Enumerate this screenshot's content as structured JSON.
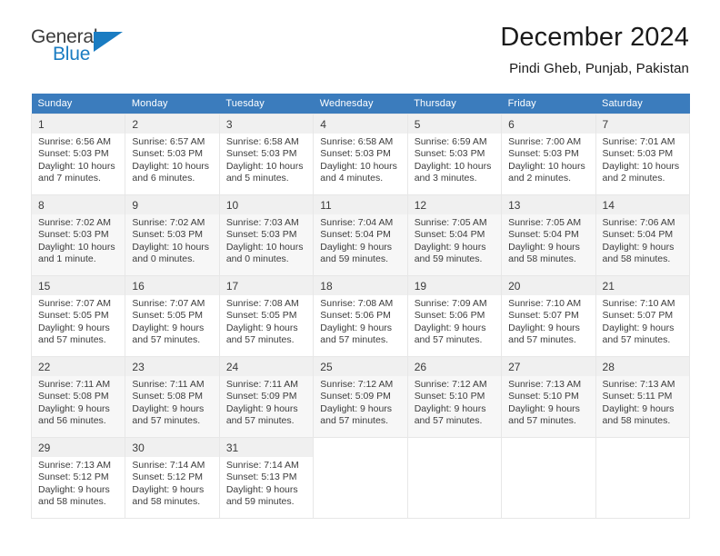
{
  "logo": {
    "word_one": "General",
    "word_two": "Blue",
    "triangle_icon": "triangle-icon",
    "brand_blue": "#1a7cc2",
    "brand_dark": "#3c3c3c"
  },
  "header": {
    "title": "December 2024",
    "subtitle": "Pindi Gheb, Punjab, Pakistan"
  },
  "calendar": {
    "header_bg": "#3b7cbd",
    "header_text_color": "#ffffff",
    "weekdays": [
      "Sunday",
      "Monday",
      "Tuesday",
      "Wednesday",
      "Thursday",
      "Friday",
      "Saturday"
    ],
    "labels": {
      "sunrise": "Sunrise:",
      "sunset": "Sunset:",
      "daylight": "Daylight:"
    },
    "weeks": [
      [
        {
          "day": "1",
          "sunrise": "Sunrise: 6:56 AM",
          "sunset": "Sunset: 5:03 PM",
          "daylight": "Daylight: 10 hours and 7 minutes."
        },
        {
          "day": "2",
          "sunrise": "Sunrise: 6:57 AM",
          "sunset": "Sunset: 5:03 PM",
          "daylight": "Daylight: 10 hours and 6 minutes."
        },
        {
          "day": "3",
          "sunrise": "Sunrise: 6:58 AM",
          "sunset": "Sunset: 5:03 PM",
          "daylight": "Daylight: 10 hours and 5 minutes."
        },
        {
          "day": "4",
          "sunrise": "Sunrise: 6:58 AM",
          "sunset": "Sunset: 5:03 PM",
          "daylight": "Daylight: 10 hours and 4 minutes."
        },
        {
          "day": "5",
          "sunrise": "Sunrise: 6:59 AM",
          "sunset": "Sunset: 5:03 PM",
          "daylight": "Daylight: 10 hours and 3 minutes."
        },
        {
          "day": "6",
          "sunrise": "Sunrise: 7:00 AM",
          "sunset": "Sunset: 5:03 PM",
          "daylight": "Daylight: 10 hours and 2 minutes."
        },
        {
          "day": "7",
          "sunrise": "Sunrise: 7:01 AM",
          "sunset": "Sunset: 5:03 PM",
          "daylight": "Daylight: 10 hours and 2 minutes."
        }
      ],
      [
        {
          "day": "8",
          "sunrise": "Sunrise: 7:02 AM",
          "sunset": "Sunset: 5:03 PM",
          "daylight": "Daylight: 10 hours and 1 minute."
        },
        {
          "day": "9",
          "sunrise": "Sunrise: 7:02 AM",
          "sunset": "Sunset: 5:03 PM",
          "daylight": "Daylight: 10 hours and 0 minutes."
        },
        {
          "day": "10",
          "sunrise": "Sunrise: 7:03 AM",
          "sunset": "Sunset: 5:03 PM",
          "daylight": "Daylight: 10 hours and 0 minutes."
        },
        {
          "day": "11",
          "sunrise": "Sunrise: 7:04 AM",
          "sunset": "Sunset: 5:04 PM",
          "daylight": "Daylight: 9 hours and 59 minutes."
        },
        {
          "day": "12",
          "sunrise": "Sunrise: 7:05 AM",
          "sunset": "Sunset: 5:04 PM",
          "daylight": "Daylight: 9 hours and 59 minutes."
        },
        {
          "day": "13",
          "sunrise": "Sunrise: 7:05 AM",
          "sunset": "Sunset: 5:04 PM",
          "daylight": "Daylight: 9 hours and 58 minutes."
        },
        {
          "day": "14",
          "sunrise": "Sunrise: 7:06 AM",
          "sunset": "Sunset: 5:04 PM",
          "daylight": "Daylight: 9 hours and 58 minutes."
        }
      ],
      [
        {
          "day": "15",
          "sunrise": "Sunrise: 7:07 AM",
          "sunset": "Sunset: 5:05 PM",
          "daylight": "Daylight: 9 hours and 57 minutes."
        },
        {
          "day": "16",
          "sunrise": "Sunrise: 7:07 AM",
          "sunset": "Sunset: 5:05 PM",
          "daylight": "Daylight: 9 hours and 57 minutes."
        },
        {
          "day": "17",
          "sunrise": "Sunrise: 7:08 AM",
          "sunset": "Sunset: 5:05 PM",
          "daylight": "Daylight: 9 hours and 57 minutes."
        },
        {
          "day": "18",
          "sunrise": "Sunrise: 7:08 AM",
          "sunset": "Sunset: 5:06 PM",
          "daylight": "Daylight: 9 hours and 57 minutes."
        },
        {
          "day": "19",
          "sunrise": "Sunrise: 7:09 AM",
          "sunset": "Sunset: 5:06 PM",
          "daylight": "Daylight: 9 hours and 57 minutes."
        },
        {
          "day": "20",
          "sunrise": "Sunrise: 7:10 AM",
          "sunset": "Sunset: 5:07 PM",
          "daylight": "Daylight: 9 hours and 57 minutes."
        },
        {
          "day": "21",
          "sunrise": "Sunrise: 7:10 AM",
          "sunset": "Sunset: 5:07 PM",
          "daylight": "Daylight: 9 hours and 57 minutes."
        }
      ],
      [
        {
          "day": "22",
          "sunrise": "Sunrise: 7:11 AM",
          "sunset": "Sunset: 5:08 PM",
          "daylight": "Daylight: 9 hours and 56 minutes."
        },
        {
          "day": "23",
          "sunrise": "Sunrise: 7:11 AM",
          "sunset": "Sunset: 5:08 PM",
          "daylight": "Daylight: 9 hours and 57 minutes."
        },
        {
          "day": "24",
          "sunrise": "Sunrise: 7:11 AM",
          "sunset": "Sunset: 5:09 PM",
          "daylight": "Daylight: 9 hours and 57 minutes."
        },
        {
          "day": "25",
          "sunrise": "Sunrise: 7:12 AM",
          "sunset": "Sunset: 5:09 PM",
          "daylight": "Daylight: 9 hours and 57 minutes."
        },
        {
          "day": "26",
          "sunrise": "Sunrise: 7:12 AM",
          "sunset": "Sunset: 5:10 PM",
          "daylight": "Daylight: 9 hours and 57 minutes."
        },
        {
          "day": "27",
          "sunrise": "Sunrise: 7:13 AM",
          "sunset": "Sunset: 5:10 PM",
          "daylight": "Daylight: 9 hours and 57 minutes."
        },
        {
          "day": "28",
          "sunrise": "Sunrise: 7:13 AM",
          "sunset": "Sunset: 5:11 PM",
          "daylight": "Daylight: 9 hours and 58 minutes."
        }
      ],
      [
        {
          "day": "29",
          "sunrise": "Sunrise: 7:13 AM",
          "sunset": "Sunset: 5:12 PM",
          "daylight": "Daylight: 9 hours and 58 minutes."
        },
        {
          "day": "30",
          "sunrise": "Sunrise: 7:14 AM",
          "sunset": "Sunset: 5:12 PM",
          "daylight": "Daylight: 9 hours and 58 minutes."
        },
        {
          "day": "31",
          "sunrise": "Sunrise: 7:14 AM",
          "sunset": "Sunset: 5:13 PM",
          "daylight": "Daylight: 9 hours and 59 minutes."
        },
        {
          "day": "",
          "sunrise": "",
          "sunset": "",
          "daylight": ""
        },
        {
          "day": "",
          "sunrise": "",
          "sunset": "",
          "daylight": ""
        },
        {
          "day": "",
          "sunrise": "",
          "sunset": "",
          "daylight": ""
        },
        {
          "day": "",
          "sunrise": "",
          "sunset": "",
          "daylight": ""
        }
      ]
    ]
  }
}
